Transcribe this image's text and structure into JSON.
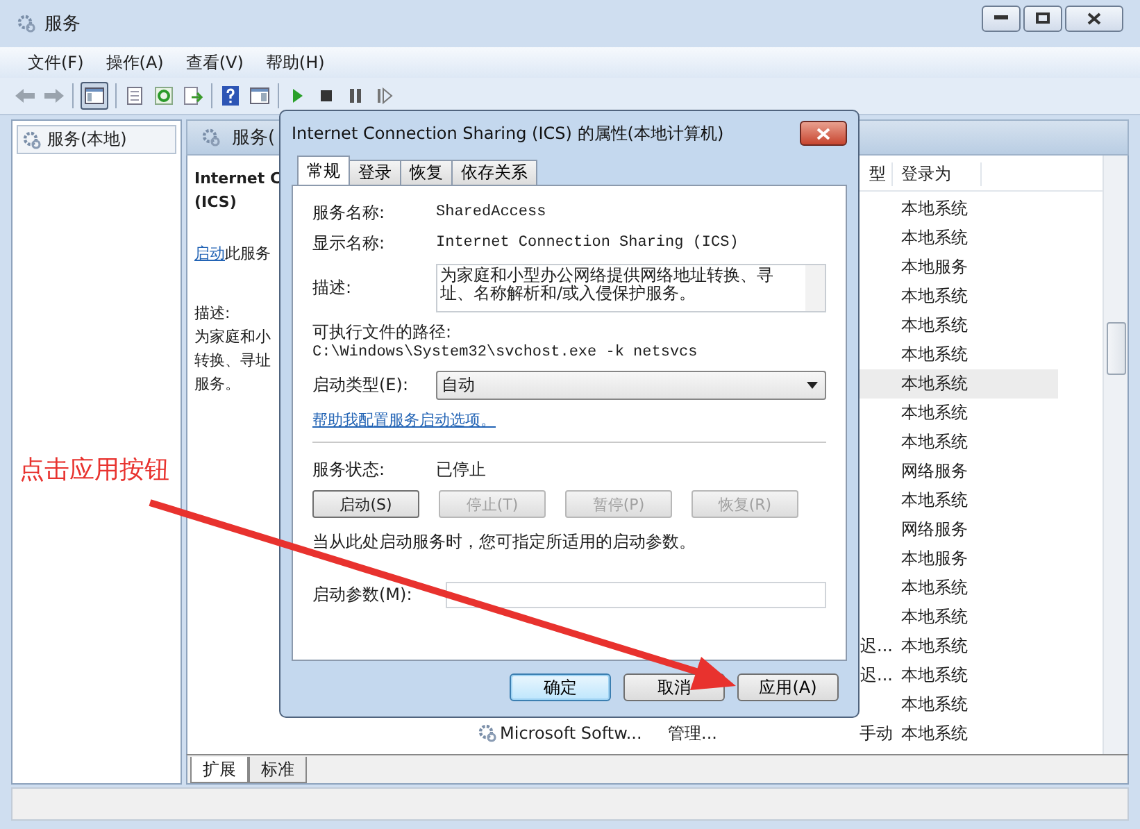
{
  "window": {
    "title": "服务",
    "menu": [
      "文件(F)",
      "操作(A)",
      "查看(V)",
      "帮助(H)"
    ]
  },
  "toolbar": {
    "tree_toggle_on": true
  },
  "tree": {
    "items": [
      {
        "label": "服务(本地)",
        "selected": true
      }
    ]
  },
  "services_pane": {
    "header": "服务(",
    "detail": {
      "title_lines": [
        "Internet C",
        "(ICS)"
      ],
      "link": "启动",
      "link_rest": "此服务",
      "description_label": "描述:",
      "description_lines": [
        "为家庭和小",
        "转换、寻址",
        "服务。"
      ]
    },
    "table": {
      "headers": {
        "startup_type": "型",
        "log_on_as": "登录为"
      },
      "rows": [
        {
          "log_on_as": "本地系统",
          "selected": false
        },
        {
          "log_on_as": "本地系统",
          "selected": false
        },
        {
          "log_on_as": "本地服务",
          "selected": false
        },
        {
          "log_on_as": "本地系统",
          "selected": false
        },
        {
          "log_on_as": "本地系统",
          "selected": false
        },
        {
          "log_on_as": "本地系统",
          "selected": false
        },
        {
          "log_on_as": "本地系统",
          "selected": true
        },
        {
          "log_on_as": "本地系统",
          "selected": false
        },
        {
          "log_on_as": "本地系统",
          "selected": false
        },
        {
          "log_on_as": "网络服务",
          "selected": false
        },
        {
          "log_on_as": "本地系统",
          "selected": false
        },
        {
          "log_on_as": "网络服务",
          "selected": false
        },
        {
          "log_on_as": "本地服务",
          "selected": false
        },
        {
          "log_on_as": "本地系统",
          "selected": false
        },
        {
          "log_on_as": "本地系统",
          "selected": false
        },
        {
          "startup_type": "迟...",
          "log_on_as": "本地系统",
          "selected": false
        },
        {
          "startup_type": "迟...",
          "log_on_as": "本地系统",
          "selected": false
        },
        {
          "log_on_as": "本地系统",
          "selected": false
        },
        {
          "name": "Microsoft Softw...",
          "description": "管理...",
          "startup_type": "手动",
          "log_on_as": "本地系统",
          "selected": false
        }
      ]
    }
  },
  "view_tabs": [
    {
      "label": "扩展",
      "selected": true
    },
    {
      "label": "标准",
      "selected": false
    }
  ],
  "dialog": {
    "title": "Internet Connection Sharing (ICS) 的属性(本地计算机)",
    "tabs": [
      {
        "label": "常规",
        "selected": true
      },
      {
        "label": "登录",
        "selected": false
      },
      {
        "label": "恢复",
        "selected": false
      },
      {
        "label": "依存关系",
        "selected": false
      }
    ],
    "service_name": {
      "label": "服务名称:",
      "value": "SharedAccess"
    },
    "display_name": {
      "label": "显示名称:",
      "value": "Internet Connection Sharing (ICS)"
    },
    "description": {
      "label": "描述:",
      "value": "为家庭和小型办公网络提供网络地址转换、寻址、名称解析和/或入侵保护服务。"
    },
    "path": {
      "label": "可执行文件的路径:",
      "value": "C:\\Windows\\System32\\svchost.exe -k netsvcs"
    },
    "startup_type": {
      "label": "启动类型(E):",
      "value": "自动"
    },
    "help_link": "帮助我配置服务启动选项。",
    "status": {
      "label": "服务状态:",
      "value": "已停止"
    },
    "control_buttons": [
      {
        "label": "启动(S)",
        "disabled": false
      },
      {
        "label": "停止(T)",
        "disabled": true
      },
      {
        "label": "暂停(P)",
        "disabled": true
      },
      {
        "label": "恢复(R)",
        "disabled": true
      }
    ],
    "hint": "当从此处启动服务时，您可指定所适用的启动参数。",
    "start_params": {
      "label": "启动参数(M):"
    },
    "buttons": [
      {
        "label": "确定",
        "default": true
      },
      {
        "label": "取消",
        "default": false
      },
      {
        "label": "应用(A)",
        "default": false
      }
    ]
  },
  "annotation": {
    "text": "点击应用按钮"
  }
}
